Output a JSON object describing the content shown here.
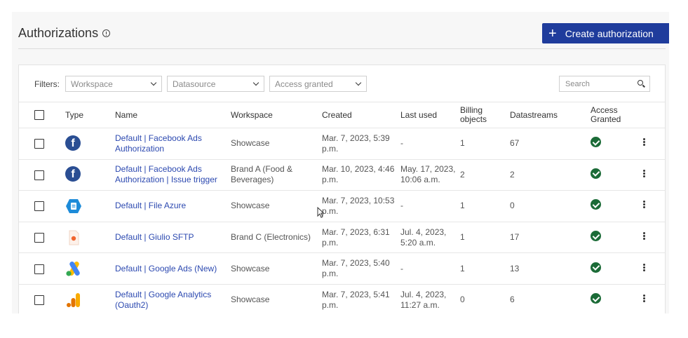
{
  "header": {
    "title": "Authorizations",
    "create_label": "Create authorization"
  },
  "filters": {
    "label": "Filters:",
    "workspace": "Workspace",
    "datasource": "Datasource",
    "access": "Access granted",
    "search_placeholder": "Search"
  },
  "columns": [
    "Type",
    "Name",
    "Workspace",
    "Created",
    "Last used",
    "Billing objects",
    "Datastreams",
    "Access Granted"
  ],
  "rows": [
    {
      "icon": "facebook-icon",
      "name": "Default | Facebook Ads Authorization",
      "workspace": "Showcase",
      "created": "Mar. 7, 2023, 5:39 p.m.",
      "last_used": "-",
      "billing": "1",
      "datastreams": "67"
    },
    {
      "icon": "facebook-icon",
      "name": "Default | Facebook Ads Authorization | Issue trigger",
      "workspace": "Brand A (Food & Beverages)",
      "created": "Mar. 10, 2023, 4:46 p.m.",
      "last_used": "May. 17, 2023, 10:06 a.m.",
      "billing": "2",
      "datastreams": "2"
    },
    {
      "icon": "azure-file-icon",
      "name": "Default | File Azure",
      "workspace": "Showcase",
      "created": "Mar. 7, 2023, 10:53 p.m.",
      "last_used": "-",
      "billing": "1",
      "datastreams": "0"
    },
    {
      "icon": "sftp-file-icon",
      "name": "Default | Giulio SFTP",
      "workspace": "Brand C (Electronics)",
      "created": "Mar. 7, 2023, 6:31 p.m.",
      "last_used": "Jul. 4, 2023, 5:20 a.m.",
      "billing": "1",
      "datastreams": "17"
    },
    {
      "icon": "google-ads-icon",
      "name": "Default | Google Ads (New)",
      "workspace": "Showcase",
      "created": "Mar. 7, 2023, 5:40 p.m.",
      "last_used": "-",
      "billing": "1",
      "datastreams": "13"
    },
    {
      "icon": "google-analytics-icon",
      "name": "Default | Google Analytics (Oauth2)",
      "workspace": "Showcase",
      "created": "Mar. 7, 2023, 5:41 p.m.",
      "last_used": "Jul. 4, 2023, 11:27 a.m.",
      "billing": "0",
      "datastreams": "6"
    }
  ],
  "colors": {
    "accent": "#1f3c9c",
    "link": "#2c49b0",
    "success": "#1b6b37",
    "facebook": "#2a4e93"
  }
}
